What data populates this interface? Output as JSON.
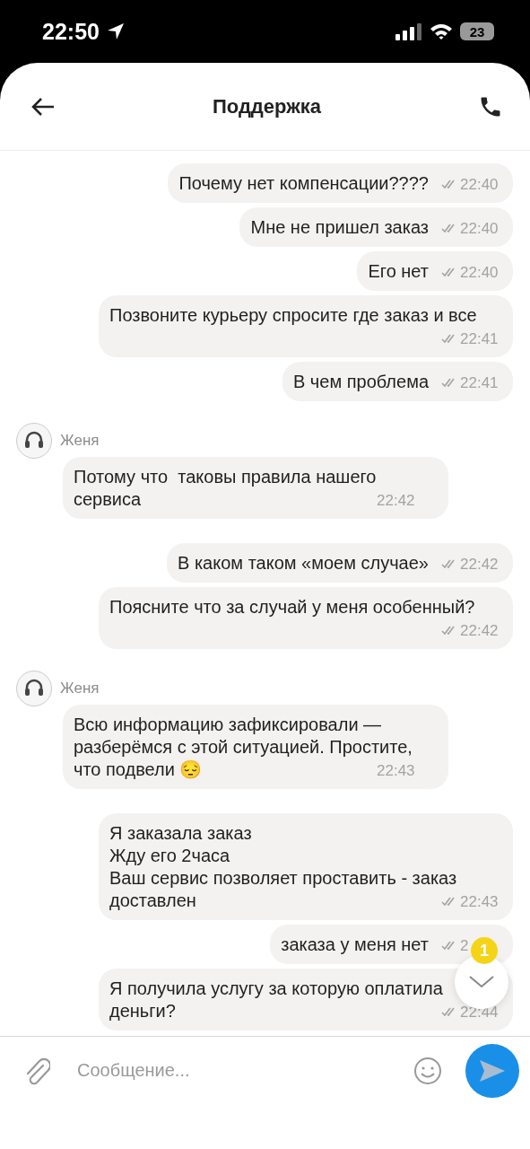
{
  "status_bar": {
    "time": "22:50",
    "battery": "23"
  },
  "header": {
    "title": "Поддержка"
  },
  "messages": [
    {
      "kind": "outgoing",
      "text": "Почему нет компенсации????",
      "time": "22:40"
    },
    {
      "kind": "outgoing",
      "text": "Мне не пришел заказ",
      "time": "22:40"
    },
    {
      "kind": "outgoing",
      "text": "Его нет",
      "time": "22:40"
    },
    {
      "kind": "outgoing",
      "text": "Позвоните курьеру спросите где заказ и все",
      "time": "22:41"
    },
    {
      "kind": "outgoing",
      "text": "В чем проблема",
      "time": "22:41"
    },
    {
      "kind": "incoming",
      "author": "Женя",
      "text": "Потому что  таковы правила нашего сервиса",
      "time": "22:42"
    },
    {
      "kind": "outgoing",
      "text": "В каком таком «моем случае»",
      "time": "22:42"
    },
    {
      "kind": "outgoing",
      "text": "Поясните что за случай у меня особенный?",
      "time": "22:42"
    },
    {
      "kind": "incoming",
      "author": "Женя",
      "text": "Всю информацию зафиксировали — разберёмся с этой ситуацией. Простите, что подвели 😔",
      "time": "22:43"
    },
    {
      "kind": "outgoing",
      "text": "Я заказала заказ\nЖду его 2часа\nВаш сервис позволяет проставить - заказ доставлен",
      "time": "22:43"
    },
    {
      "kind": "outgoing",
      "text": "заказа у меня нет",
      "time": "2"
    },
    {
      "kind": "outgoing",
      "text": "Я получила услугу за которую оплатила деньги?",
      "time": "22:44"
    }
  ],
  "scroll_button": {
    "badge": "1"
  },
  "composer": {
    "placeholder": "Сообщение..."
  }
}
